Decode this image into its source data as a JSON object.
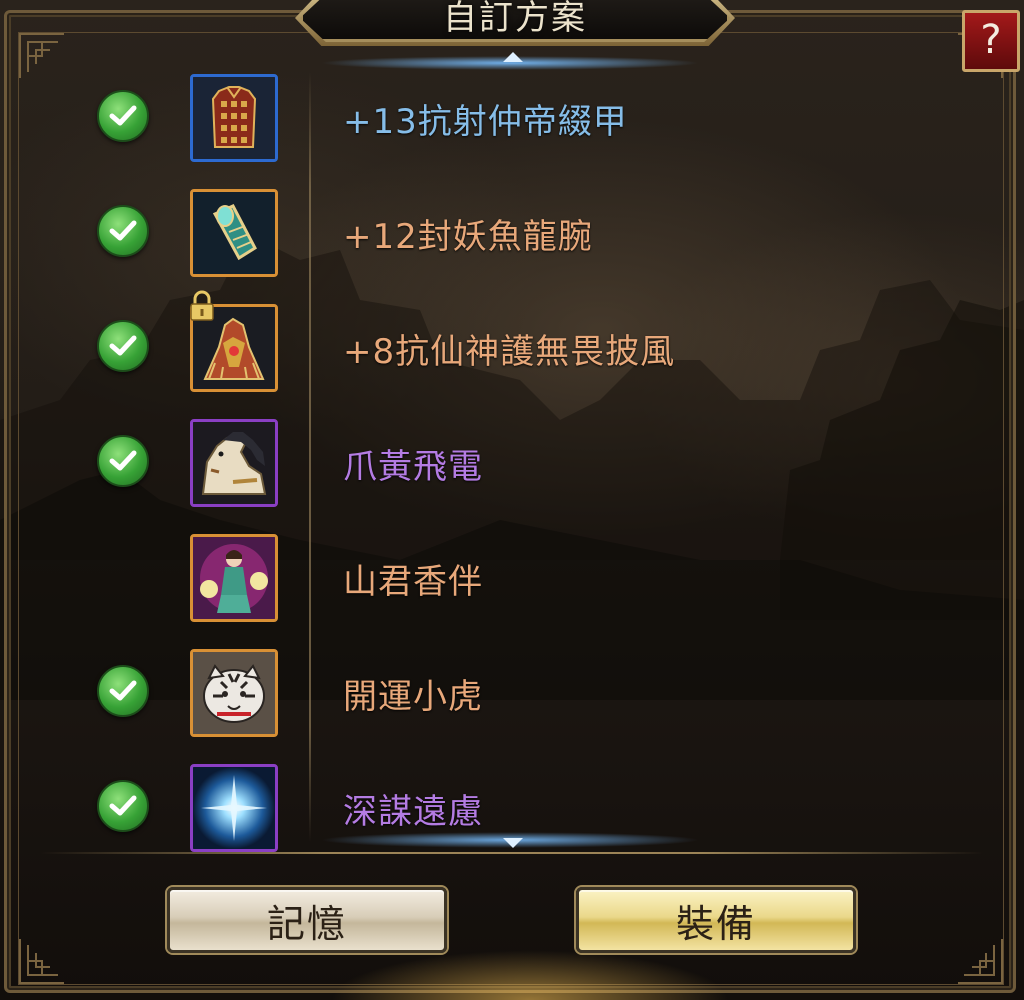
{
  "window": {
    "title": "自訂方案",
    "help_label": "?"
  },
  "items": [
    {
      "name": "+13抗射仲帝綴甲",
      "checked": true,
      "locked": false,
      "rarity_color": "#2d6ad0",
      "name_color": "#86bde8",
      "icon": "armor-icon"
    },
    {
      "name": "+12封妖魚龍腕",
      "checked": true,
      "locked": false,
      "rarity_color": "#d89035",
      "name_color": "#e8a87a",
      "icon": "bracer-icon"
    },
    {
      "name": "+8抗仙神護無畏披風",
      "checked": true,
      "locked": true,
      "rarity_color": "#d89035",
      "name_color": "#e8a87a",
      "icon": "cloak-icon"
    },
    {
      "name": "爪黃飛電",
      "checked": true,
      "locked": false,
      "rarity_color": "#8a3fc4",
      "name_color": "#b47ce3",
      "icon": "horse-icon"
    },
    {
      "name": "山君香伴",
      "checked": false,
      "locked": false,
      "rarity_color": "#d89035",
      "name_color": "#e8a87a",
      "icon": "companion-icon"
    },
    {
      "name": "開運小虎",
      "checked": true,
      "locked": false,
      "rarity_color": "#d89035",
      "name_color": "#e8a87a",
      "icon": "tiger-icon"
    },
    {
      "name": "深謀遠慮",
      "checked": true,
      "locked": false,
      "rarity_color": "#8a3fc4",
      "name_color": "#b47ce3",
      "icon": "skill-icon"
    }
  ],
  "buttons": {
    "memory_label": "記憶",
    "equip_label": "裝備"
  }
}
